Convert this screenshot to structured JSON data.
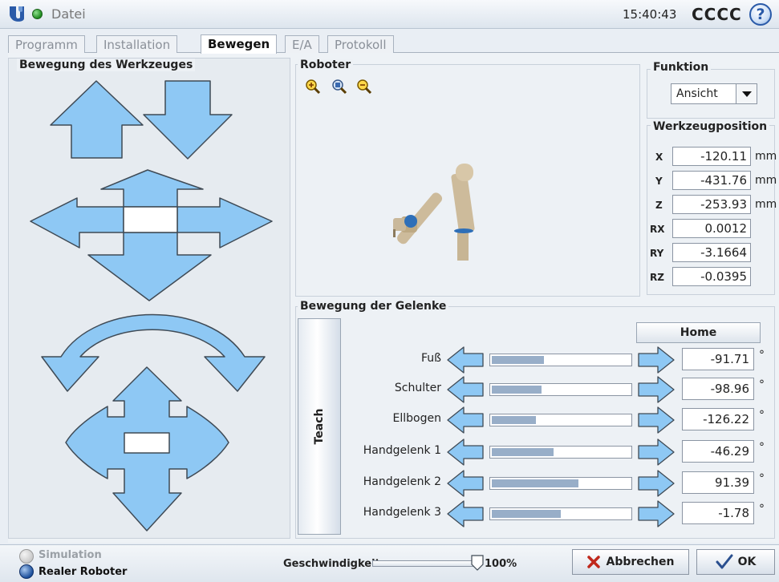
{
  "header": {
    "menu_label": "Datei",
    "time": "15:40:43",
    "robot_name": "CCCC",
    "help_label": "?"
  },
  "tabs": [
    {
      "label": "Programm"
    },
    {
      "label": "Installation"
    },
    {
      "label": "Bewegen"
    },
    {
      "label": "E/A"
    },
    {
      "label": "Protokoll"
    }
  ],
  "tool_panel": {
    "title": "Bewegung des Werkzeuges"
  },
  "robot_panel": {
    "title": "Roboter"
  },
  "function_panel": {
    "title": "Funktion",
    "selected": "Ansicht"
  },
  "tool_position": {
    "title": "Werkzeugposition",
    "fields": [
      {
        "label": "X",
        "value": "-120.11",
        "unit": "mm"
      },
      {
        "label": "Y",
        "value": "-431.76",
        "unit": "mm"
      },
      {
        "label": "Z",
        "value": "-253.93",
        "unit": "mm"
      },
      {
        "label": "RX",
        "value": "0.0012",
        "unit": ""
      },
      {
        "label": "RY",
        "value": "-3.1664",
        "unit": ""
      },
      {
        "label": "RZ",
        "value": "-0.0395",
        "unit": ""
      }
    ]
  },
  "joints_panel": {
    "title": "Bewegung der Gelenke",
    "teach_label": "Teach",
    "home_label": "Home",
    "degree_symbol": "°",
    "joints": [
      {
        "name": "Fuß",
        "value": "-91.71",
        "fill": 0.38
      },
      {
        "name": "Schulter",
        "value": "-98.96",
        "fill": 0.36
      },
      {
        "name": "Ellbogen",
        "value": "-126.22",
        "fill": 0.32
      },
      {
        "name": "Handgelenk 1",
        "value": "-46.29",
        "fill": 0.45
      },
      {
        "name": "Handgelenk 2",
        "value": "91.39",
        "fill": 0.63
      },
      {
        "name": "Handgelenk 3",
        "value": "-1.78",
        "fill": 0.5
      }
    ]
  },
  "footer": {
    "simulation_label": "Simulation",
    "real_robot_label": "Realer Roboter",
    "speed_label": "Geschwindigkeit",
    "speed_value": "100%",
    "speed_fraction": 1.0,
    "cancel_label": "Abbrechen",
    "ok_label": "OK"
  },
  "colors": {
    "arrow_fill": "#8ec8f4",
    "arrow_stroke": "#3f4a55",
    "bar_fill": "#98aec8",
    "robot_metal": "#c9b89a",
    "joint_ring": "#2e6fb8"
  },
  "icons": {
    "logo": "ur-logo-icon",
    "status": "status-dot-icon",
    "help": "help-icon",
    "zoom_in": "zoom-in-icon",
    "zoom_reset": "zoom-reset-icon",
    "zoom_out": "zoom-out-icon",
    "cancel": "x-icon",
    "ok": "checkmark-icon"
  }
}
